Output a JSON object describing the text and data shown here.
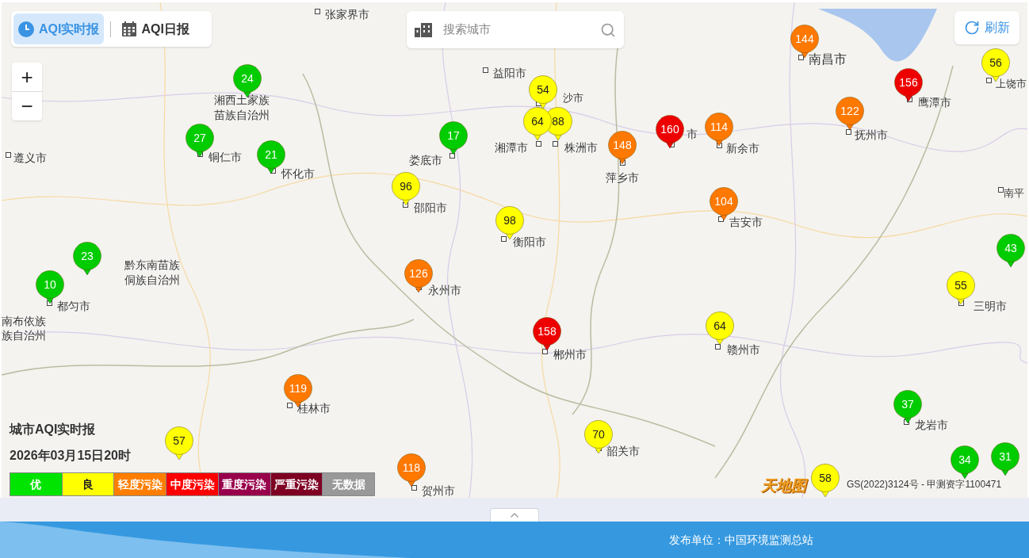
{
  "tabs": [
    {
      "label": "AQI实时报",
      "selected": true
    },
    {
      "label": "AQI日报",
      "selected": false
    }
  ],
  "search": {
    "placeholder": "搜索城市"
  },
  "refresh": {
    "label": "刷新"
  },
  "zoom": {
    "in": "+",
    "out": "−"
  },
  "markers": [
    {
      "value": "24",
      "color": "#00cc00"
    },
    {
      "value": "27",
      "color": "#00cc00"
    },
    {
      "value": "21",
      "color": "#00cc00"
    },
    {
      "value": "17",
      "color": "#00cc00"
    },
    {
      "value": "96",
      "color": "#ffff00"
    },
    {
      "value": "98",
      "color": "#ffff00"
    },
    {
      "value": "54",
      "color": "#ffff00"
    },
    {
      "value": "88",
      "color": "#ffff00"
    },
    {
      "value": "64",
      "color": "#ffff00"
    },
    {
      "value": "148",
      "color": "#ff7800"
    },
    {
      "value": "160",
      "color": "#ee0000"
    },
    {
      "value": "114",
      "color": "#ff7800"
    },
    {
      "value": "144",
      "color": "#ff7800"
    },
    {
      "value": "122",
      "color": "#ff7800"
    },
    {
      "value": "156",
      "color": "#ee0000"
    },
    {
      "value": "56",
      "color": "#ffff00"
    },
    {
      "value": "104",
      "color": "#ff7800"
    },
    {
      "value": "43",
      "color": "#00cc00"
    },
    {
      "value": "55",
      "color": "#ffff00"
    },
    {
      "value": "23",
      "color": "#00cc00"
    },
    {
      "value": "10",
      "color": "#00cc00"
    },
    {
      "value": "126",
      "color": "#ff7800"
    },
    {
      "value": "158",
      "color": "#ee0000"
    },
    {
      "value": "64",
      "color": "#ffff00"
    },
    {
      "value": "119",
      "color": "#ff7800"
    },
    {
      "value": "57",
      "color": "#ffff00"
    },
    {
      "value": "118",
      "color": "#ff7800"
    },
    {
      "value": "70",
      "color": "#ffff00"
    },
    {
      "value": "37",
      "color": "#00cc00"
    },
    {
      "value": "34",
      "color": "#00cc00"
    },
    {
      "value": "31",
      "color": "#00cc00"
    },
    {
      "value": "58",
      "color": "#ffff00"
    }
  ],
  "places": [
    "张家界市",
    "益阳市",
    "沙市",
    "湘潭市",
    "株洲市",
    "萍乡市",
    "市",
    "新余市",
    "南昌市",
    "抚州市",
    "鹰潭市",
    "上饶市",
    "南平",
    "吉安市",
    "遵义市",
    "铜仁市",
    "怀化市",
    "湘西土家族苗族自治州",
    "娄底市",
    "邵阳市",
    "衡阳市",
    "黔东南苗族侗族自治州",
    "都匀市",
    "南布依族",
    "族自治州",
    "永州市",
    "郴州市",
    "赣州市",
    "三明市",
    "龙岩市",
    "桂林市",
    "韶关市",
    "贺州市"
  ],
  "legend": {
    "title": "城市AQI实时报",
    "time": "2026年03月15日20时",
    "items": [
      {
        "label": "优",
        "color": "#00e400"
      },
      {
        "label": "良",
        "color": "#ffff00"
      },
      {
        "label": "轻度污染",
        "color": "#ff7e00"
      },
      {
        "label": "中度污染",
        "color": "#ff0000"
      },
      {
        "label": "重度污染",
        "color": "#99004c"
      },
      {
        "label": "严重污染",
        "color": "#7e0023"
      },
      {
        "label": "无数据",
        "color": "#999999"
      }
    ]
  },
  "map_logo": "天地图",
  "attribution": "GS(2022)3124号 - 甲测资字1100471",
  "footer": {
    "publisher": "发布单位：中国环境监测总站"
  }
}
